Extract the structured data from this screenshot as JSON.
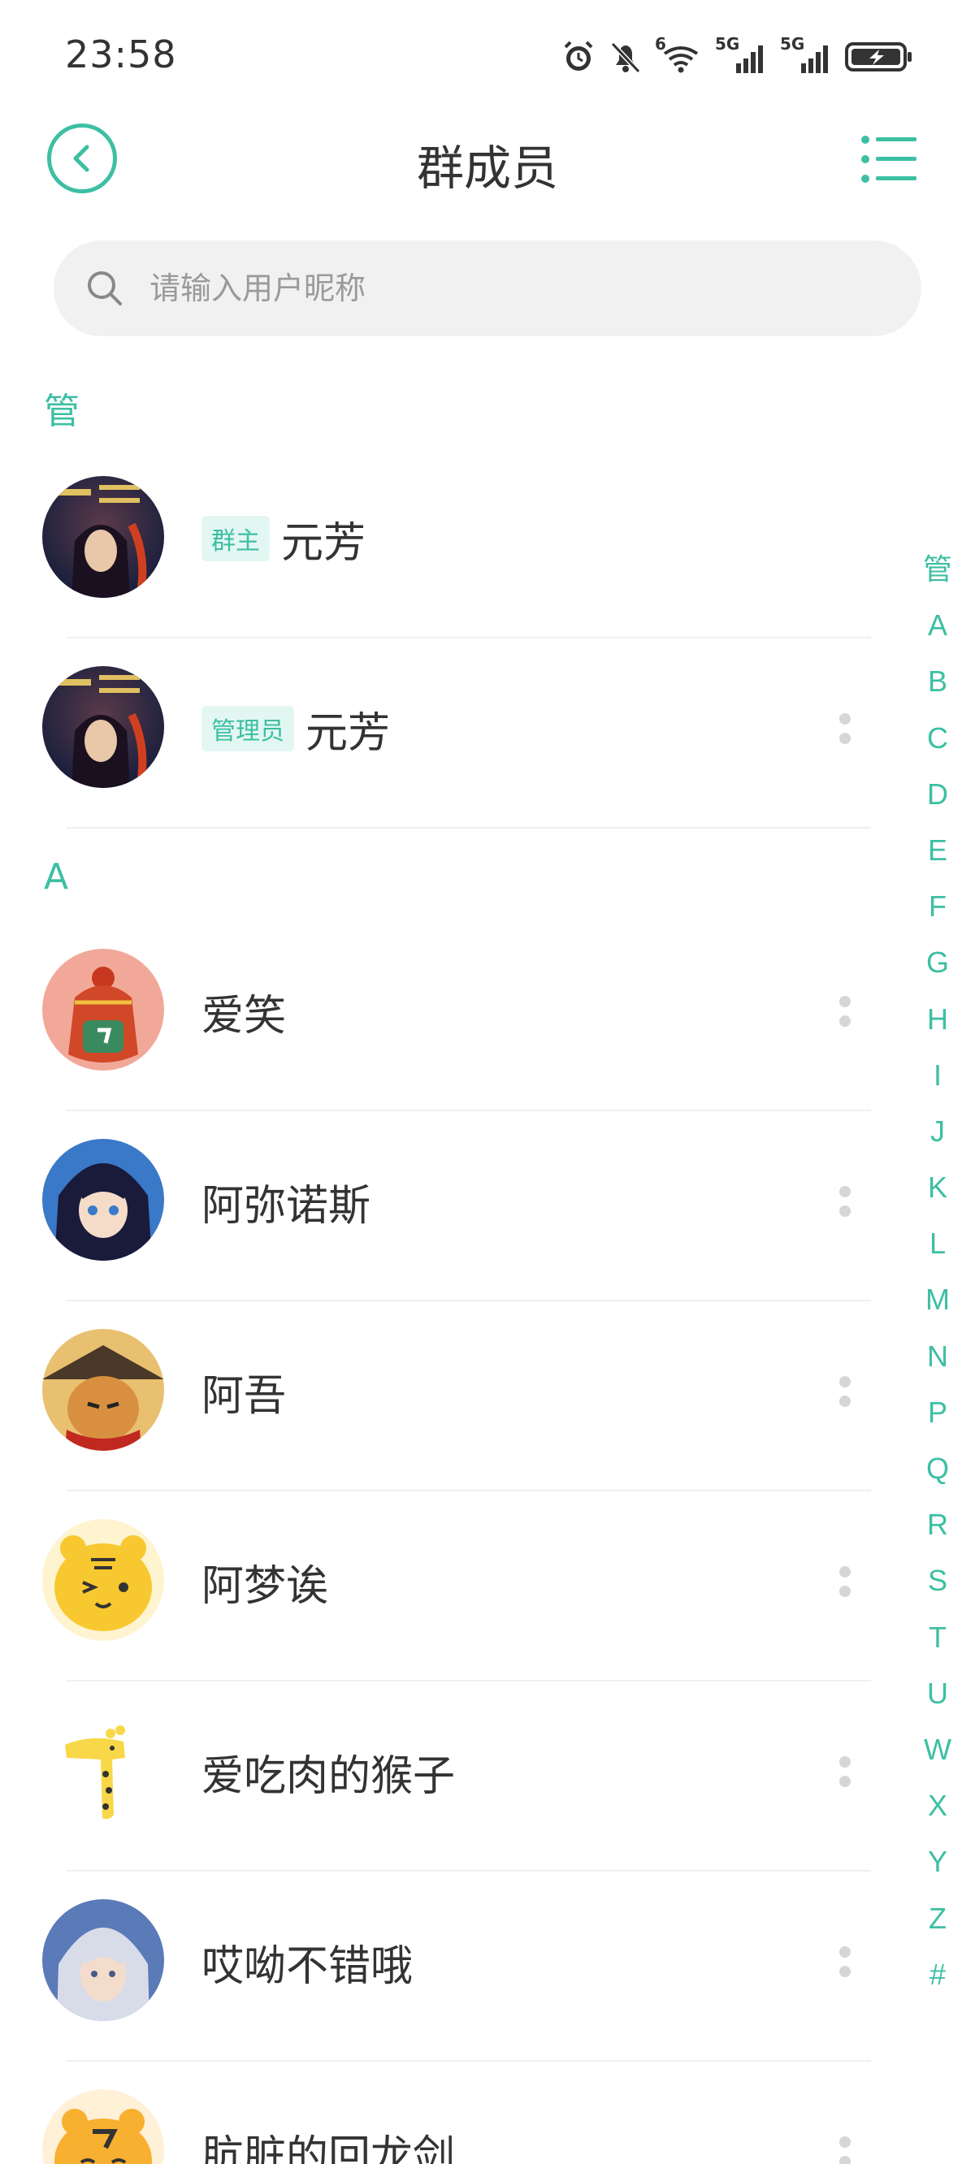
{
  "status_bar": {
    "time": "23:58",
    "icons": [
      "alarm-icon",
      "mute-bell-icon",
      "wifi-icon",
      "signal-5g-icon",
      "signal-5g-icon",
      "battery-charging-icon"
    ],
    "wifi_label": "6",
    "sim1_label": "5G",
    "sim2_label": "5G"
  },
  "header": {
    "title": "群成员",
    "back_icon": "back-arrow-icon",
    "menu_icon": "list-menu-icon"
  },
  "search": {
    "placeholder": "请输入用户昵称"
  },
  "sections": [
    {
      "header": "管",
      "members": [
        {
          "name": "元芳",
          "role": "群主",
          "avatar": "yuanfang-poster",
          "has_more": false
        },
        {
          "name": "元芳",
          "role": "管理员",
          "avatar": "yuanfang-poster",
          "has_more": true
        }
      ]
    },
    {
      "header": "A",
      "members": [
        {
          "name": "爱笑",
          "role": "",
          "avatar": "red-robot",
          "has_more": true
        },
        {
          "name": "阿弥诺斯",
          "role": "",
          "avatar": "anime-boy",
          "has_more": true
        },
        {
          "name": "阿吾",
          "role": "",
          "avatar": "bear-hat",
          "has_more": true
        },
        {
          "name": "阿梦诶",
          "role": "",
          "avatar": "yellow-tiger",
          "has_more": true
        },
        {
          "name": "爱吃肉的猴子",
          "role": "",
          "avatar": "giraffe",
          "has_more": true
        },
        {
          "name": "哎呦不错哦",
          "role": "",
          "avatar": "silver-hair-girl",
          "has_more": true
        },
        {
          "name": "肮脏的回龙剑",
          "role": "",
          "avatar": "tiger-cub",
          "has_more": true
        }
      ]
    }
  ],
  "alpha_index": [
    "管",
    "A",
    "B",
    "C",
    "D",
    "E",
    "F",
    "G",
    "H",
    "I",
    "J",
    "K",
    "L",
    "M",
    "N",
    "P",
    "Q",
    "R",
    "S",
    "T",
    "U",
    "W",
    "X",
    "Y",
    "Z",
    "#"
  ],
  "colors": {
    "accent": "#3dbfa3",
    "badge_bg": "#e3f7f2",
    "search_bg": "#f1f1f1",
    "text": "#333333"
  }
}
